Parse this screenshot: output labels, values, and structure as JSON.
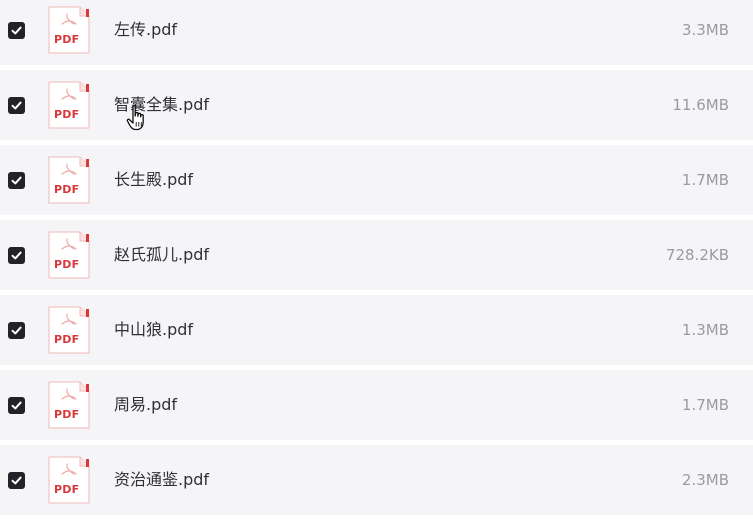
{
  "files": [
    {
      "name": "左传.pdf",
      "size": "3.3MB",
      "checked": true,
      "icon": "pdf-icon"
    },
    {
      "name": "智囊全集.pdf",
      "size": "11.6MB",
      "checked": true,
      "icon": "pdf-icon"
    },
    {
      "name": "长生殿.pdf",
      "size": "1.7MB",
      "checked": true,
      "icon": "pdf-icon"
    },
    {
      "name": "赵氏孤儿.pdf",
      "size": "728.2KB",
      "checked": true,
      "icon": "pdf-icon"
    },
    {
      "name": "中山狼.pdf",
      "size": "1.3MB",
      "checked": true,
      "icon": "pdf-icon"
    },
    {
      "name": "周易.pdf",
      "size": "1.7MB",
      "checked": true,
      "icon": "pdf-icon"
    },
    {
      "name": "资治通鉴.pdf",
      "size": "2.3MB",
      "checked": true,
      "icon": "pdf-icon"
    }
  ],
  "icon_label": "PDF",
  "colors": {
    "row_background": "#f5f5f7",
    "checkbox": "#222228",
    "pdf_red": "#d9383a",
    "file_name": "#2f2f37",
    "file_size": "#9a9aa2"
  },
  "cursor": "hand-pointer-icon"
}
